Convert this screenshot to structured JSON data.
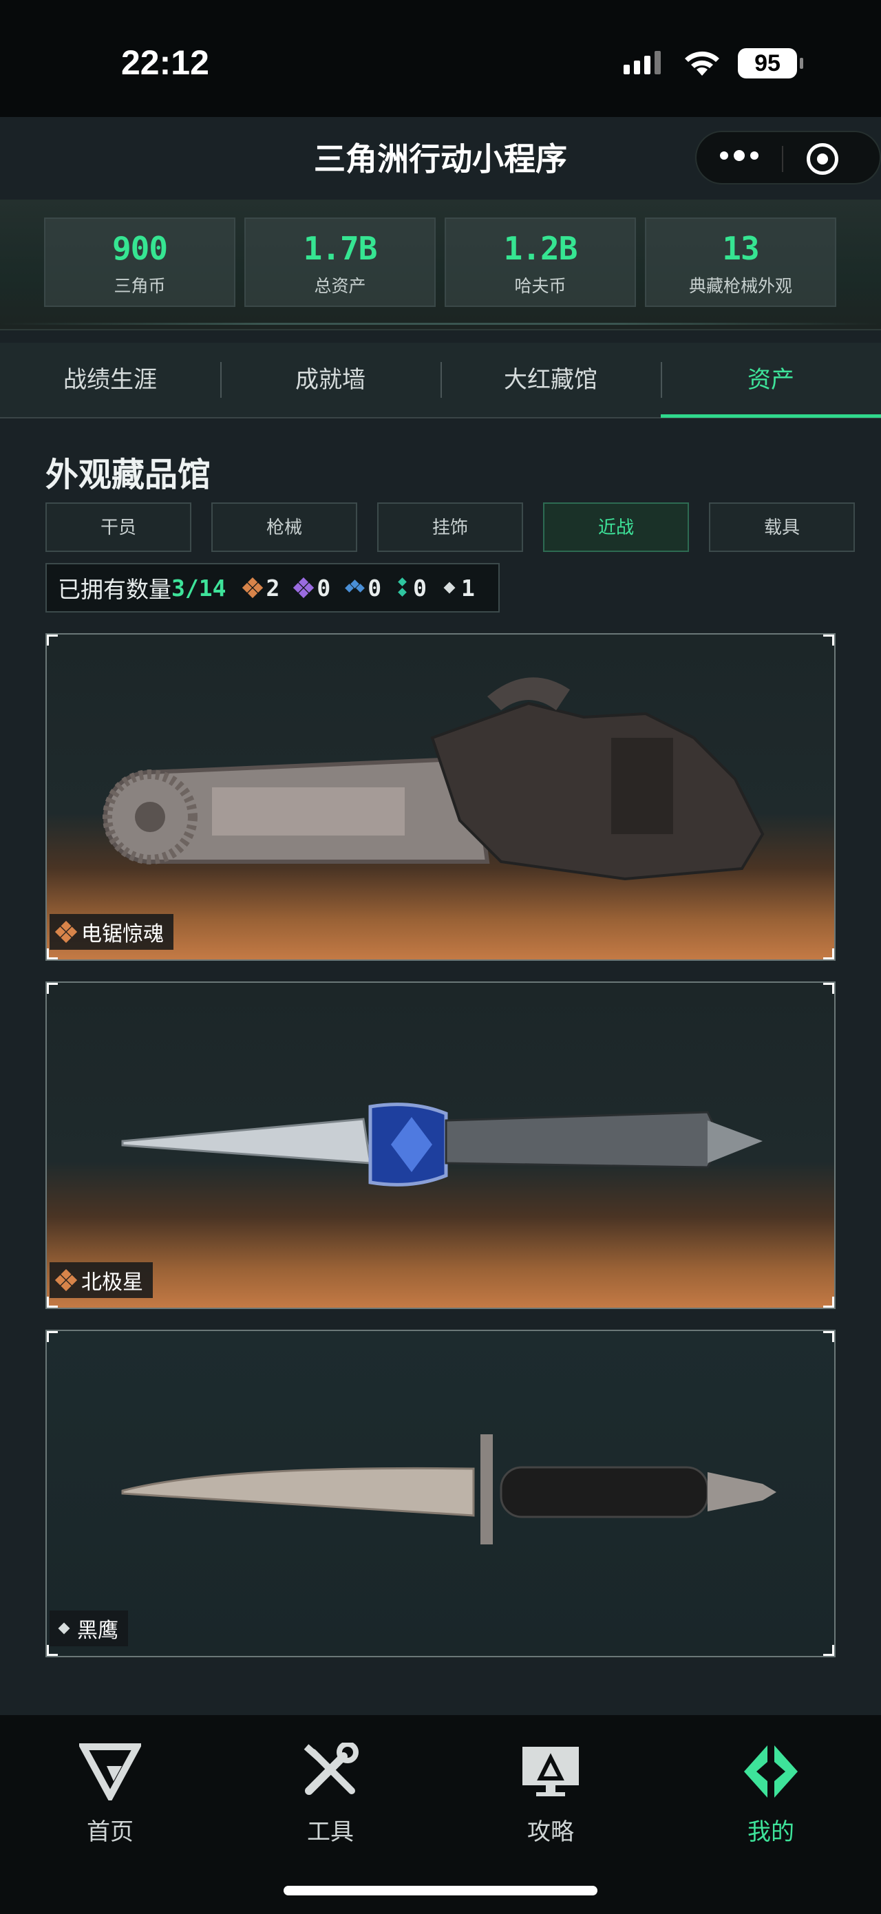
{
  "status_bar": {
    "time": "22:12",
    "battery": "95"
  },
  "header": {
    "title": "三角洲行动小程序"
  },
  "stats": [
    {
      "value": "900",
      "label": "三角币"
    },
    {
      "value": "1.7B",
      "label": "总资产"
    },
    {
      "value": "1.2B",
      "label": "哈夫币"
    },
    {
      "value": "13",
      "label": "典藏枪械外观"
    }
  ],
  "tabs": [
    "战绩生涯",
    "成就墙",
    "大红藏馆",
    "资产"
  ],
  "section": {
    "title": "外观藏品馆",
    "filters": [
      "干员",
      "枪械",
      "挂饰",
      "近战",
      "载具"
    ],
    "owned_label": "已拥有数量",
    "owned_count": "3/14",
    "rarity_counts": [
      "2",
      "0",
      "0",
      "0",
      "1"
    ]
  },
  "cards": [
    {
      "name": "电锯惊魂",
      "rarity": "orange",
      "icon": "chainsaw"
    },
    {
      "name": "北极星",
      "rarity": "orange",
      "icon": "blue-dagger"
    },
    {
      "name": "黑鹰",
      "rarity": "white",
      "icon": "combat-knife"
    }
  ],
  "bottom_nav": [
    {
      "label": "首页",
      "icon": "home-logo-icon"
    },
    {
      "label": "工具",
      "icon": "tools-icon"
    },
    {
      "label": "攻略",
      "icon": "guide-icon"
    },
    {
      "label": "我的",
      "icon": "profile-icon"
    }
  ],
  "colors": {
    "accent": "#3ee39a",
    "orange": "#d8844a",
    "purple": "#9a6be0",
    "blue": "#4a8fd6",
    "teal": "#2fc6a0"
  }
}
